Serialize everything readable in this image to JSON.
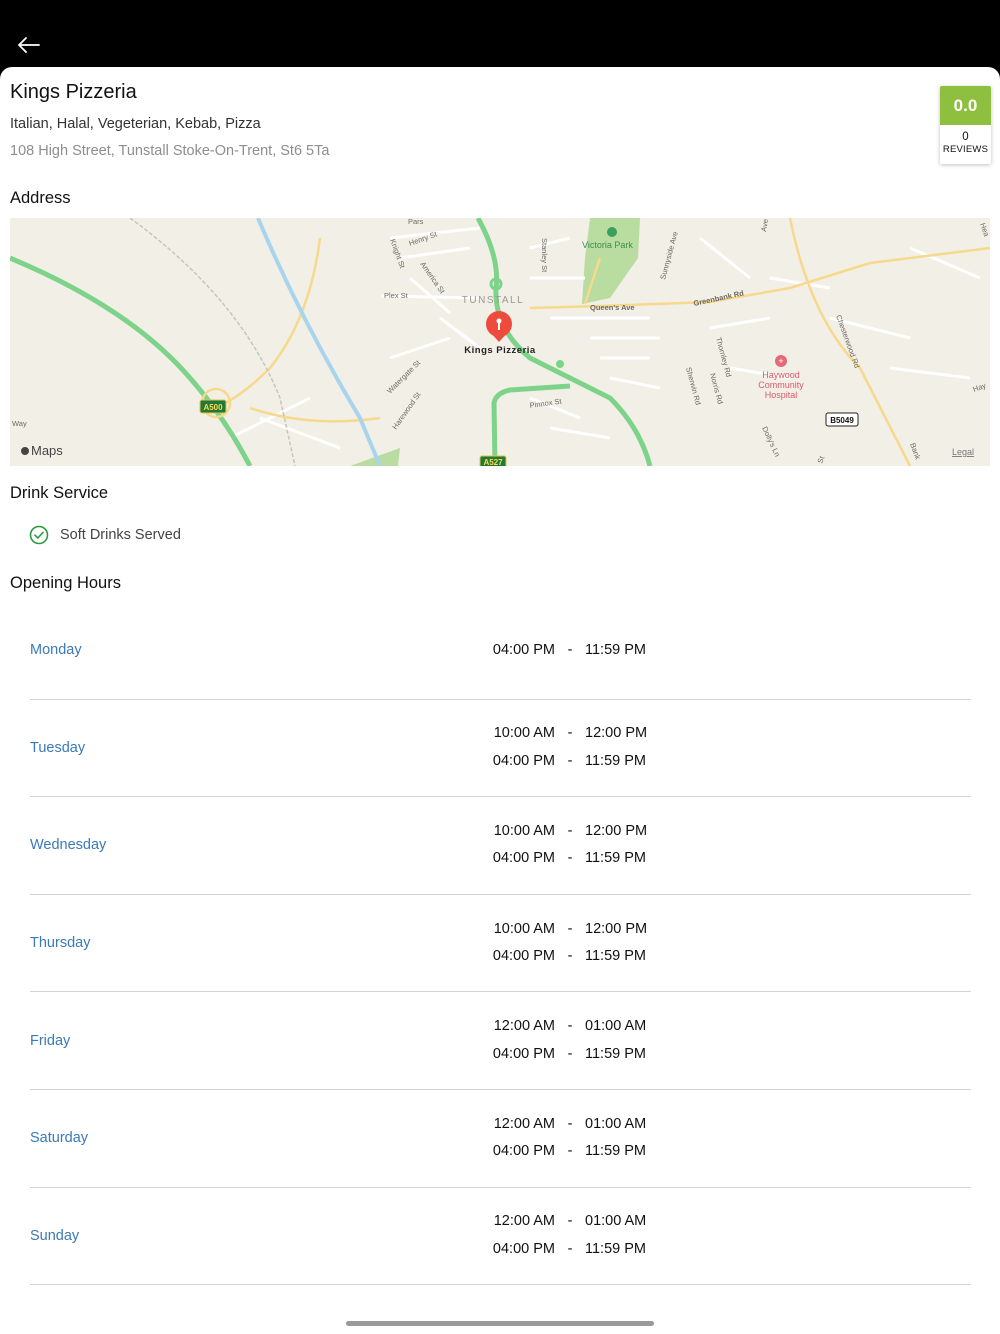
{
  "restaurant": {
    "name": "Kings Pizzeria",
    "cuisines": "Italian, Halal, Vegeterian, Kebab, Pizza",
    "address": "108 High Street, Tunstall Stoke-On-Trent, St6 5Ta"
  },
  "rating": {
    "score": "0.0",
    "count": "0",
    "label": "REVIEWS",
    "color": "#8fbf3e"
  },
  "sections": {
    "address": "Address",
    "drink_service": "Drink Service",
    "opening_hours": "Opening Hours"
  },
  "map": {
    "pin_label": "Kings Pizzeria",
    "area_label": "TUNSTALL",
    "park_label": "Victoria Park",
    "hospital_label": "Haywood Community Hospital",
    "hospital_line1": "Haywood",
    "hospital_line2": "Community",
    "hospital_line3": "Hospital",
    "brand": "Maps",
    "legal": "Legal",
    "road_badges": [
      "A500",
      "A527",
      "B5049"
    ],
    "streets": [
      "Pars",
      "Henry St",
      "Knight St",
      "America St",
      "Plex St",
      "Stanley St",
      "Sunnyside Ave",
      "Queen's Ave",
      "Greenbank Rd",
      "Ave",
      "Chesterwood Rd",
      "Thornley Rd",
      "Norris Rd",
      "Sherwin Rd",
      "Watergate St",
      "Harewood St",
      "Pinnox St",
      "Dolly's Ln",
      "Way",
      "Bank",
      "Hay",
      "Hea",
      "St"
    ]
  },
  "drink_service": {
    "items": [
      {
        "label": "Soft Drinks Served",
        "icon": "check-circle-icon"
      }
    ]
  },
  "hours": [
    {
      "day": "Monday",
      "slots": [
        {
          "open": "04:00 PM",
          "close": "11:59 PM"
        }
      ]
    },
    {
      "day": "Tuesday",
      "slots": [
        {
          "open": "10:00 AM",
          "close": "12:00 PM"
        },
        {
          "open": "04:00 PM",
          "close": "11:59 PM"
        }
      ]
    },
    {
      "day": "Wednesday",
      "slots": [
        {
          "open": "10:00 AM",
          "close": "12:00 PM"
        },
        {
          "open": "04:00 PM",
          "close": "11:59 PM"
        }
      ]
    },
    {
      "day": "Thursday",
      "slots": [
        {
          "open": "10:00 AM",
          "close": "12:00 PM"
        },
        {
          "open": "04:00 PM",
          "close": "11:59 PM"
        }
      ]
    },
    {
      "day": "Friday",
      "slots": [
        {
          "open": "12:00 AM",
          "close": "01:00 AM"
        },
        {
          "open": "04:00 PM",
          "close": "11:59 PM"
        }
      ]
    },
    {
      "day": "Saturday",
      "slots": [
        {
          "open": "12:00 AM",
          "close": "01:00 AM"
        },
        {
          "open": "04:00 PM",
          "close": "11:59 PM"
        }
      ]
    },
    {
      "day": "Sunday",
      "slots": [
        {
          "open": "12:00 AM",
          "close": "01:00 AM"
        },
        {
          "open": "04:00 PM",
          "close": "11:59 PM"
        }
      ]
    }
  ],
  "separator": "-",
  "colors": {
    "day_link": "#3a7ab8",
    "check": "#2e9a3e",
    "pin": "#ef4b3c",
    "major_road": "#7ed38a"
  }
}
